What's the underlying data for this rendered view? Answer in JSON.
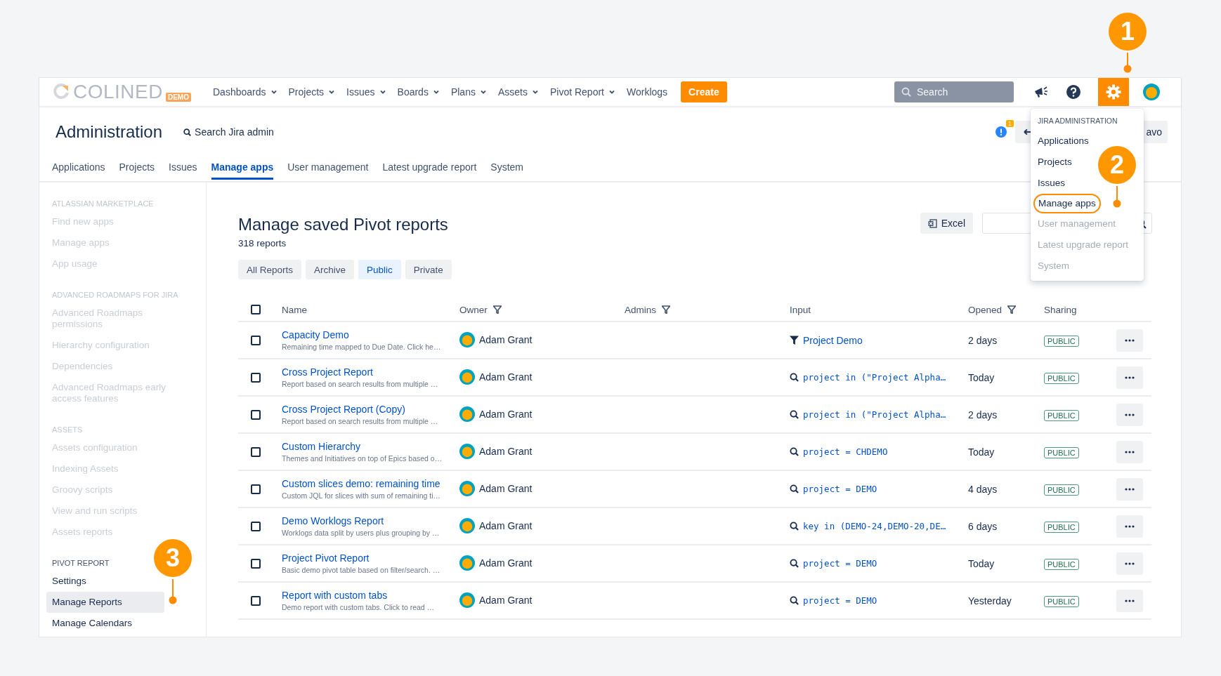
{
  "navbar": {
    "logo": "COLINED",
    "logo_badge": "DEMO",
    "items": [
      {
        "label": "Dashboards",
        "dropdown": true
      },
      {
        "label": "Projects",
        "dropdown": true
      },
      {
        "label": "Issues",
        "dropdown": true
      },
      {
        "label": "Boards",
        "dropdown": true
      },
      {
        "label": "Plans",
        "dropdown": true
      },
      {
        "label": "Assets",
        "dropdown": true
      },
      {
        "label": "Pivot Report",
        "dropdown": true
      },
      {
        "label": "Worklogs",
        "dropdown": false
      }
    ],
    "create": "Create",
    "search": {
      "placeholder": "Search"
    },
    "settings": {
      "selected": true
    }
  },
  "admin": {
    "title": "Administration",
    "search": "Search Jira admin",
    "notification_badge": "1",
    "partial_button": "avo",
    "tabs": [
      {
        "label": "Applications",
        "selected": false
      },
      {
        "label": "Projects",
        "selected": false
      },
      {
        "label": "Issues",
        "selected": false
      },
      {
        "label": "Manage apps",
        "selected": true
      },
      {
        "label": "User management",
        "selected": false
      },
      {
        "label": "Latest upgrade report",
        "selected": false
      },
      {
        "label": "System",
        "selected": false
      }
    ]
  },
  "sidebar": {
    "sections": [
      {
        "heading": "ATLASSIAN MARKETPLACE",
        "disabled": true,
        "items": [
          {
            "label": "Find new apps",
            "disabled": true,
            "selected": false
          },
          {
            "label": "Manage apps",
            "disabled": true,
            "selected": false
          },
          {
            "label": "App usage",
            "disabled": true,
            "selected": false
          }
        ]
      },
      {
        "heading": "ADVANCED ROADMAPS FOR JIRA",
        "disabled": true,
        "items": [
          {
            "label": "Advanced Roadmaps permissions",
            "disabled": true,
            "selected": false
          },
          {
            "label": "Hierarchy configuration",
            "disabled": true,
            "selected": false
          },
          {
            "label": "Dependencies",
            "disabled": true,
            "selected": false
          },
          {
            "label": "Advanced Roadmaps early access features",
            "disabled": true,
            "selected": false
          }
        ]
      },
      {
        "heading": "ASSETS",
        "disabled": true,
        "items": [
          {
            "label": "Assets configuration",
            "disabled": true,
            "selected": false
          },
          {
            "label": "Indexing Assets",
            "disabled": true,
            "selected": false
          },
          {
            "label": "Groovy scripts",
            "disabled": true,
            "selected": false
          },
          {
            "label": "View and run scripts",
            "disabled": true,
            "selected": false
          },
          {
            "label": "Assets reports",
            "disabled": true,
            "selected": false
          }
        ]
      },
      {
        "heading": "PIVOT REPORT",
        "disabled": false,
        "items": [
          {
            "label": "Settings",
            "disabled": false,
            "selected": false
          },
          {
            "label": "Manage Reports",
            "disabled": false,
            "selected": true
          },
          {
            "label": "Manage Calendars",
            "disabled": false,
            "selected": false
          }
        ]
      }
    ]
  },
  "content": {
    "title": "Manage saved Pivot reports",
    "count": "318 reports",
    "export": "Excel",
    "filters": [
      {
        "label": "All Reports",
        "selected": false
      },
      {
        "label": "Archive",
        "selected": false
      },
      {
        "label": "Public",
        "selected": true
      },
      {
        "label": "Private",
        "selected": false
      }
    ],
    "table": {
      "select_all": {
        "checked": false
      },
      "columns": [
        {
          "label": "Name",
          "filter": false
        },
        {
          "label": "Owner",
          "filter": true
        },
        {
          "label": "Admins",
          "filter": true
        },
        {
          "label": "Input",
          "filter": false
        },
        {
          "label": "Opened",
          "filter": true
        },
        {
          "label": "Sharing",
          "filter": false
        }
      ],
      "rows": [
        {
          "checked": false,
          "name": "Capacity Demo",
          "description": "Remaining time mapped to Due Date. Click he…",
          "owner": "Adam Grant",
          "input": {
            "kind": "filter",
            "text": "Project Demo"
          },
          "opened": "2 days",
          "sharing": "PUBLIC"
        },
        {
          "checked": false,
          "name": "Cross Project Report",
          "description": "Report based on search results from multiple …",
          "owner": "Adam Grant",
          "input": {
            "kind": "query",
            "text": "project in (\"Project Alpha…"
          },
          "opened": "Today",
          "sharing": "PUBLIC"
        },
        {
          "checked": false,
          "name": "Cross Project Report (Copy)",
          "description": "Report based on search results from multiple …",
          "owner": "Adam Grant",
          "input": {
            "kind": "query",
            "text": "project in (\"Project Alpha…"
          },
          "opened": "2 days",
          "sharing": "PUBLIC"
        },
        {
          "checked": false,
          "name": "Custom Hierarchy",
          "description": "Themes and Initiatives on top of Epics based o…",
          "owner": "Adam Grant",
          "input": {
            "kind": "query",
            "text": "project = CHDEMO"
          },
          "opened": "Today",
          "sharing": "PUBLIC"
        },
        {
          "checked": false,
          "name": "Custom slices demo: remaining time",
          "description": "Custom JQL for slices with sum of remaining ti…",
          "owner": "Adam Grant",
          "input": {
            "kind": "query",
            "text": "project = DEMO"
          },
          "opened": "4 days",
          "sharing": "PUBLIC"
        },
        {
          "checked": false,
          "name": "Demo Worklogs Report",
          "description": "Worklogs data split by users plus grouping by …",
          "owner": "Adam Grant",
          "input": {
            "kind": "query",
            "text": "key in (DEMO-24,DEMO-20,DE…"
          },
          "opened": "6 days",
          "sharing": "PUBLIC"
        },
        {
          "checked": false,
          "name": "Project Pivot Report",
          "description": "Basic demo pivot table based on filter/search. …",
          "owner": "Adam Grant",
          "input": {
            "kind": "query",
            "text": "project = DEMO"
          },
          "opened": "Today",
          "sharing": "PUBLIC"
        },
        {
          "checked": false,
          "name": "Report with custom tabs",
          "description": "Demo report with custom tabs. Click to read …",
          "owner": "Adam Grant",
          "input": {
            "kind": "query",
            "text": "project = DEMO"
          },
          "opened": "Yesterday",
          "sharing": "PUBLIC"
        }
      ]
    }
  },
  "dropdown": {
    "heading": "JIRA ADMINISTRATION",
    "items": [
      {
        "label": "Applications",
        "disabled": false,
        "highlighted": false
      },
      {
        "label": "Projects",
        "disabled": false,
        "highlighted": false
      },
      {
        "label": "Issues",
        "disabled": false,
        "highlighted": false
      },
      {
        "label": "Manage apps",
        "disabled": false,
        "highlighted": true
      },
      {
        "label": "User management",
        "disabled": true,
        "highlighted": false
      },
      {
        "label": "Latest upgrade report",
        "disabled": true,
        "highlighted": false
      },
      {
        "label": "System",
        "disabled": true,
        "highlighted": false
      }
    ]
  },
  "callouts": [
    {
      "number": "1"
    },
    {
      "number": "2"
    },
    {
      "number": "3"
    }
  ]
}
